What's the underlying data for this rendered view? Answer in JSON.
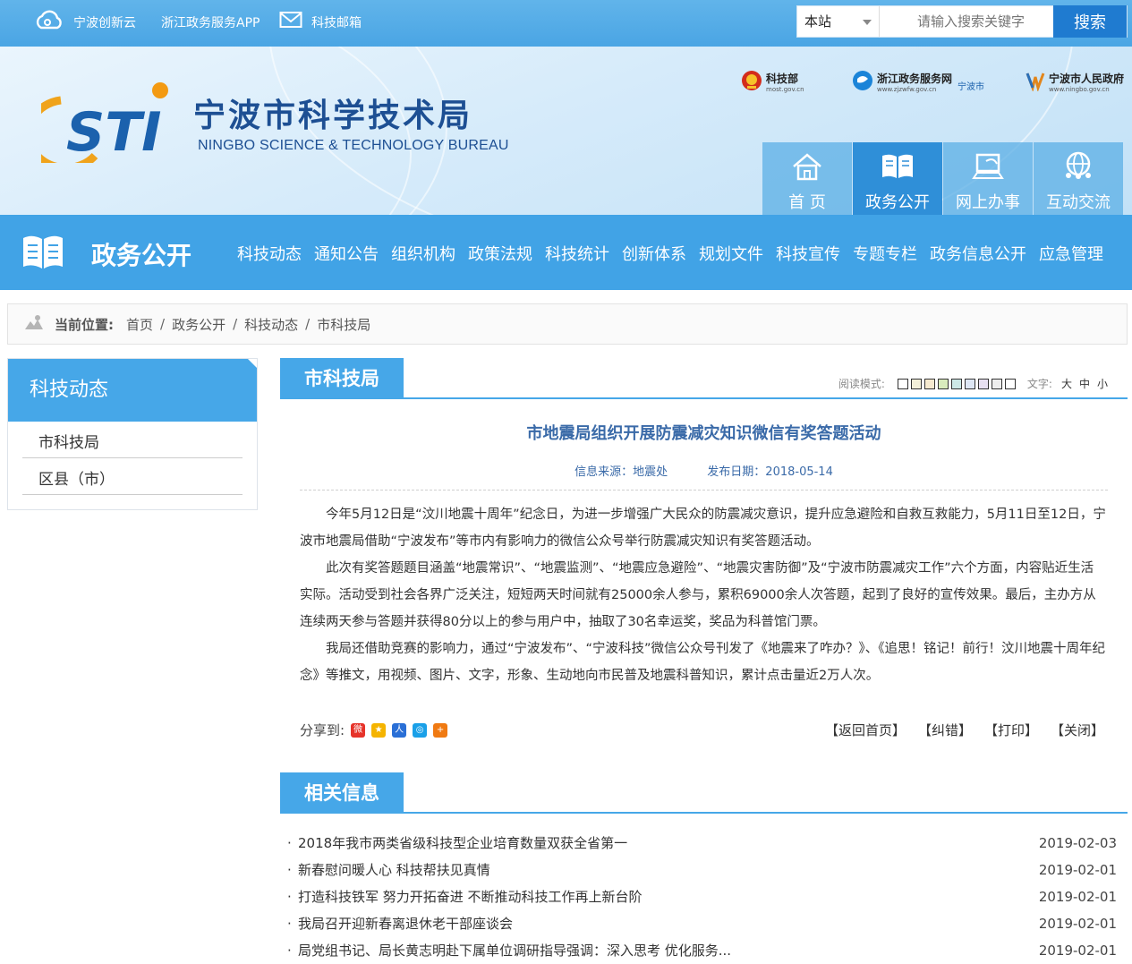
{
  "topbar": {
    "links": [
      "宁波创新云",
      "浙江政务服务APP",
      "科技邮箱"
    ],
    "search_scope": "本站",
    "search_placeholder": "请输入搜索关键字",
    "search_button": "搜索"
  },
  "brand": {
    "logo_text": "STI",
    "title": "宁波市科学技术局",
    "subtitle": "NINGBO SCIENCE & TECHNOLOGY BUREAU"
  },
  "partners": [
    {
      "name": "科技部",
      "sub": "most.gov.cn"
    },
    {
      "name": "浙江政务服务网",
      "sub": "www.zjzwfw.gov.cn",
      "extra": "宁波市"
    },
    {
      "name": "宁波市人民政府",
      "sub": "www.ningbo.gov.cn"
    }
  ],
  "main_nav": [
    {
      "label": "首 页",
      "icon": "home-icon"
    },
    {
      "label": "政务公开",
      "icon": "book-icon",
      "active": true
    },
    {
      "label": "网上办事",
      "icon": "computer-icon"
    },
    {
      "label": "互动交流",
      "icon": "globe-people-icon"
    }
  ],
  "section": {
    "title": "政务公开",
    "subnav": [
      "科技动态",
      "通知公告",
      "组织机构",
      "政策法规",
      "科技统计",
      "创新体系",
      "规划文件",
      "科技宣传",
      "专题专栏",
      "政务信息公开",
      "应急管理"
    ]
  },
  "breadcrumb": {
    "label": "当前位置:",
    "items": [
      "首页",
      "政务公开",
      "科技动态",
      "市科技局"
    ],
    "sep": "/"
  },
  "sidebar": {
    "title": "科技动态",
    "items": [
      "市科技局",
      "区县（市）"
    ]
  },
  "article": {
    "tab": "市科技局",
    "tools": {
      "read_mode": "阅读模式:",
      "text_label": "文字:",
      "sizes": [
        "大",
        "中",
        "小"
      ]
    },
    "swatches": [
      "#ffffff",
      "#f3f0d9",
      "#f6ead0",
      "#d9ecbd",
      "#cce8e6",
      "#dde6f4",
      "#e7e0f1",
      "#eeeeee",
      "#ffffff"
    ],
    "title": "市地震局组织开展防震减灾知识微信有奖答题活动",
    "source": "信息来源：地震处",
    "date": "发布日期：2018-05-14",
    "paragraphs": [
      "今年5月12日是“汶川地震十周年”纪念日，为进一步增强广大民众的防震减灾意识，提升应急避险和自救互救能力，5月11日至12日，宁波市地震局借助“宁波发布”等市内有影响力的微信公众号举行防震减灾知识有奖答题活动。",
      "此次有奖答题题目涵盖“地震常识”、“地震监测”、“地震应急避险”、“地震灾害防御”及“宁波市防震减灾工作”六个方面，内容贴近生活实际。活动受到社会各界广泛关注，短短两天时间就有25000余人参与，累积69000余人次答题，起到了良好的宣传效果。最后，主办方从连续两天参与答题并获得80分以上的参与用户中，抽取了30名幸运奖，奖品为科普馆门票。",
      "我局还借助竞赛的影响力，通过“宁波发布”、“宁波科技”微信公众号刊发了《地震来了咋办？》、《追思！铭记！前行！汶川地震十周年纪念》等推文，用视频、图片、文字，形象、生动地向市民普及地震科普知识，累计点击量近2万人次。"
    ],
    "share_label": "分享到:",
    "actions": [
      "【返回首页】",
      "【纠错】",
      "【打印】",
      "【关闭】"
    ]
  },
  "related": {
    "title": "相关信息",
    "items": [
      {
        "title": "2018年我市两类省级科技型企业培育数量双获全省第一",
        "date": "2019-02-03"
      },
      {
        "title": "新春慰问暖人心 科技帮扶见真情",
        "date": "2019-02-01"
      },
      {
        "title": "打造科技铁军 努力开拓奋进 不断推动科技工作再上新台阶",
        "date": "2019-02-01"
      },
      {
        "title": "我局召开迎新春离退休老干部座谈会",
        "date": "2019-02-01"
      },
      {
        "title": "局党组书记、局长黄志明赴下属单位调研指导强调：深入思考 优化服务...",
        "date": "2019-02-01"
      }
    ]
  }
}
